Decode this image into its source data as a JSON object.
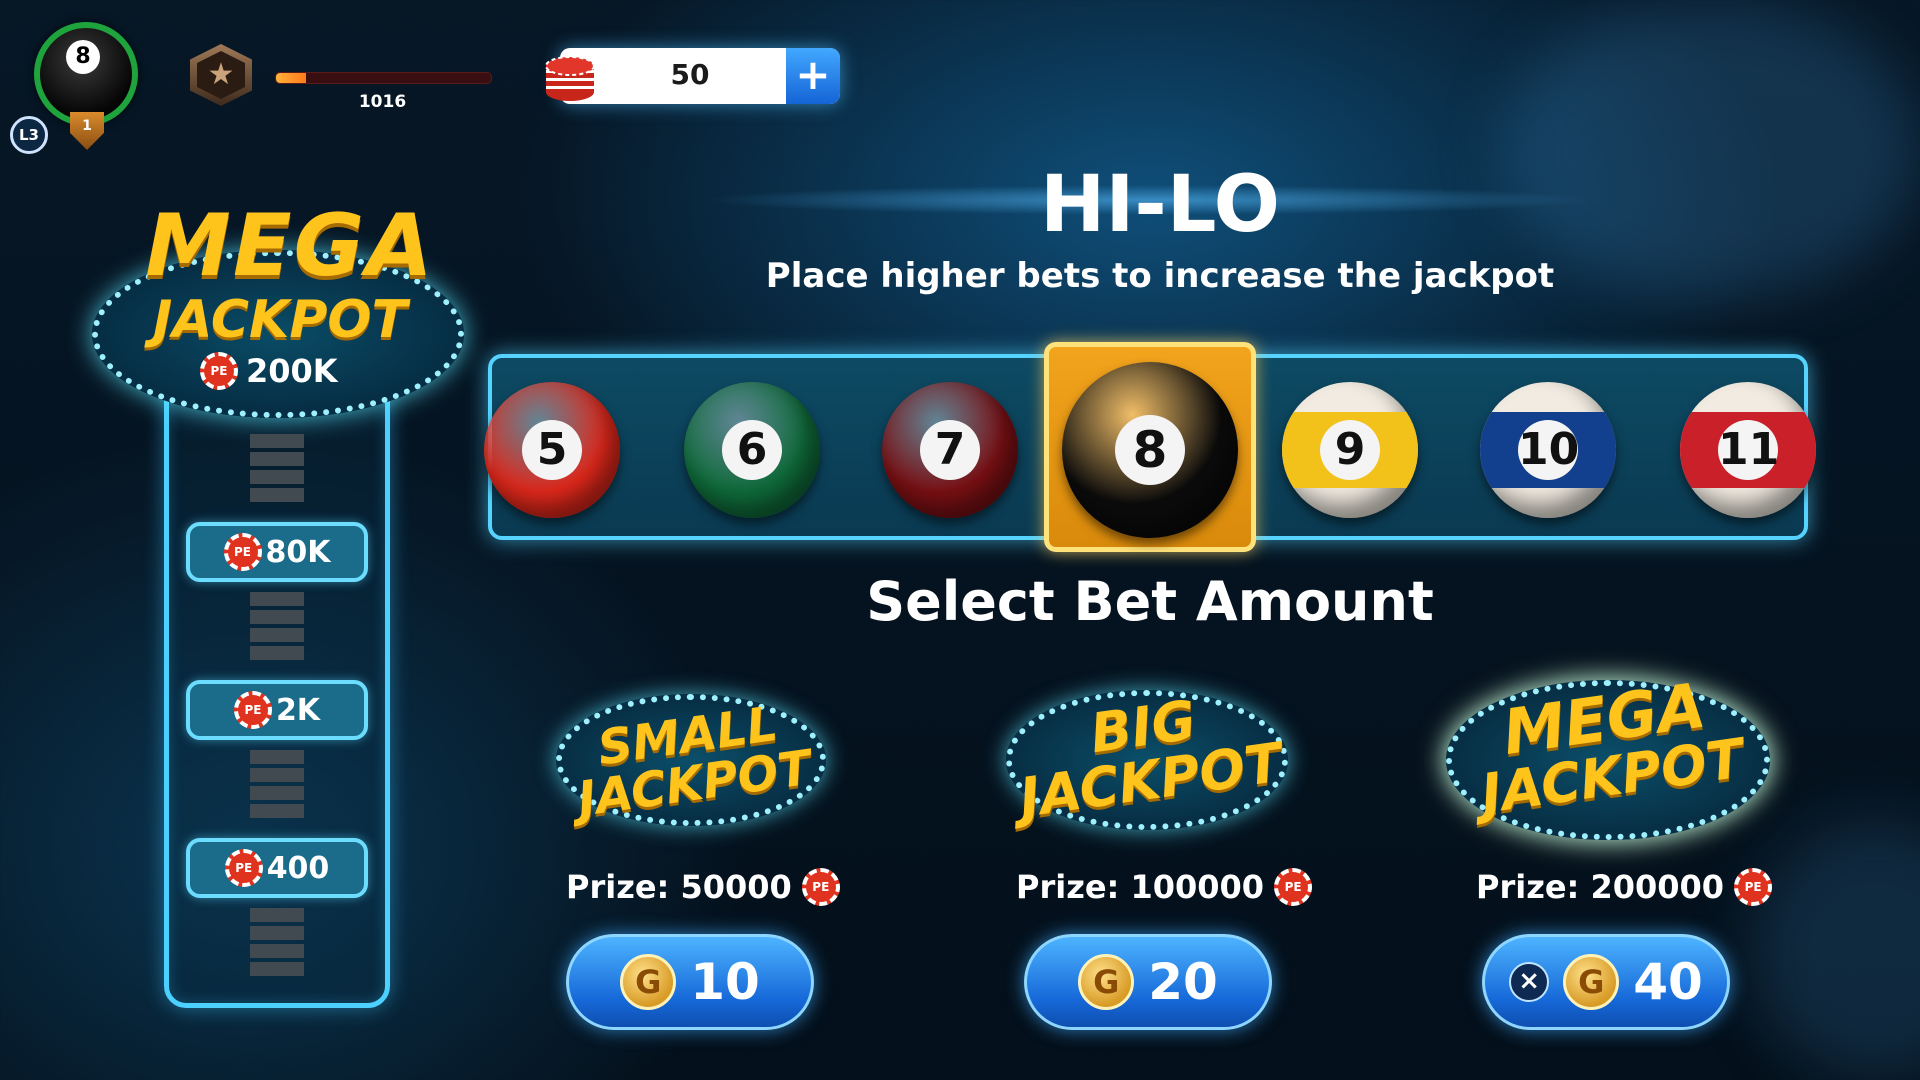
{
  "hud": {
    "player_ball_number": "8",
    "level_label": "L3",
    "rank_number": "1",
    "xp_value": "1016",
    "xp_progress": 0.14,
    "chip_count": "50",
    "plus_label": "+",
    "star_icon": "star-icon"
  },
  "jackpot_column": {
    "title_line1": "MEGA",
    "title_line2": "JACKPOT",
    "top_value": "200K",
    "tiers": [
      "80K",
      "2K",
      "400"
    ],
    "chip_label": "PE"
  },
  "game": {
    "title": "HI-LO",
    "subtitle": "Place higher bets to increase the jackpot",
    "selected_ball": "8",
    "balls": [
      {
        "number": "5",
        "color": "#e0281b",
        "striped": false
      },
      {
        "number": "6",
        "color": "#0f6b3a",
        "striped": false
      },
      {
        "number": "7",
        "color": "#7a1014",
        "striped": false
      },
      {
        "number": "8",
        "color": "#0b0b0b",
        "striped": false
      },
      {
        "number": "9",
        "color": "#f2c21a",
        "striped": true
      },
      {
        "number": "10",
        "color": "#123f8e",
        "striped": true
      },
      {
        "number": "11",
        "color": "#c9202a",
        "striped": true
      }
    ]
  },
  "bets": {
    "title": "Select Bet Amount",
    "options": [
      {
        "line1": "SMALL",
        "line2": "JACKPOT",
        "prize": "Prize: 50000",
        "amount": "10",
        "coin": "G"
      },
      {
        "line1": "BIG",
        "line2": "JACKPOT",
        "prize": "Prize: 100000",
        "amount": "20",
        "coin": "G"
      },
      {
        "line1": "MEGA",
        "line2": "JACKPOT",
        "prize": "Prize: 200000",
        "amount": "40",
        "coin": "G",
        "multiplier": "×"
      }
    ]
  },
  "colors": {
    "accent_gold": "#ffc41b",
    "glow_cyan": "#4bd0ff",
    "button_blue": "#1668d8",
    "selected_frame": "#f2a41d"
  }
}
